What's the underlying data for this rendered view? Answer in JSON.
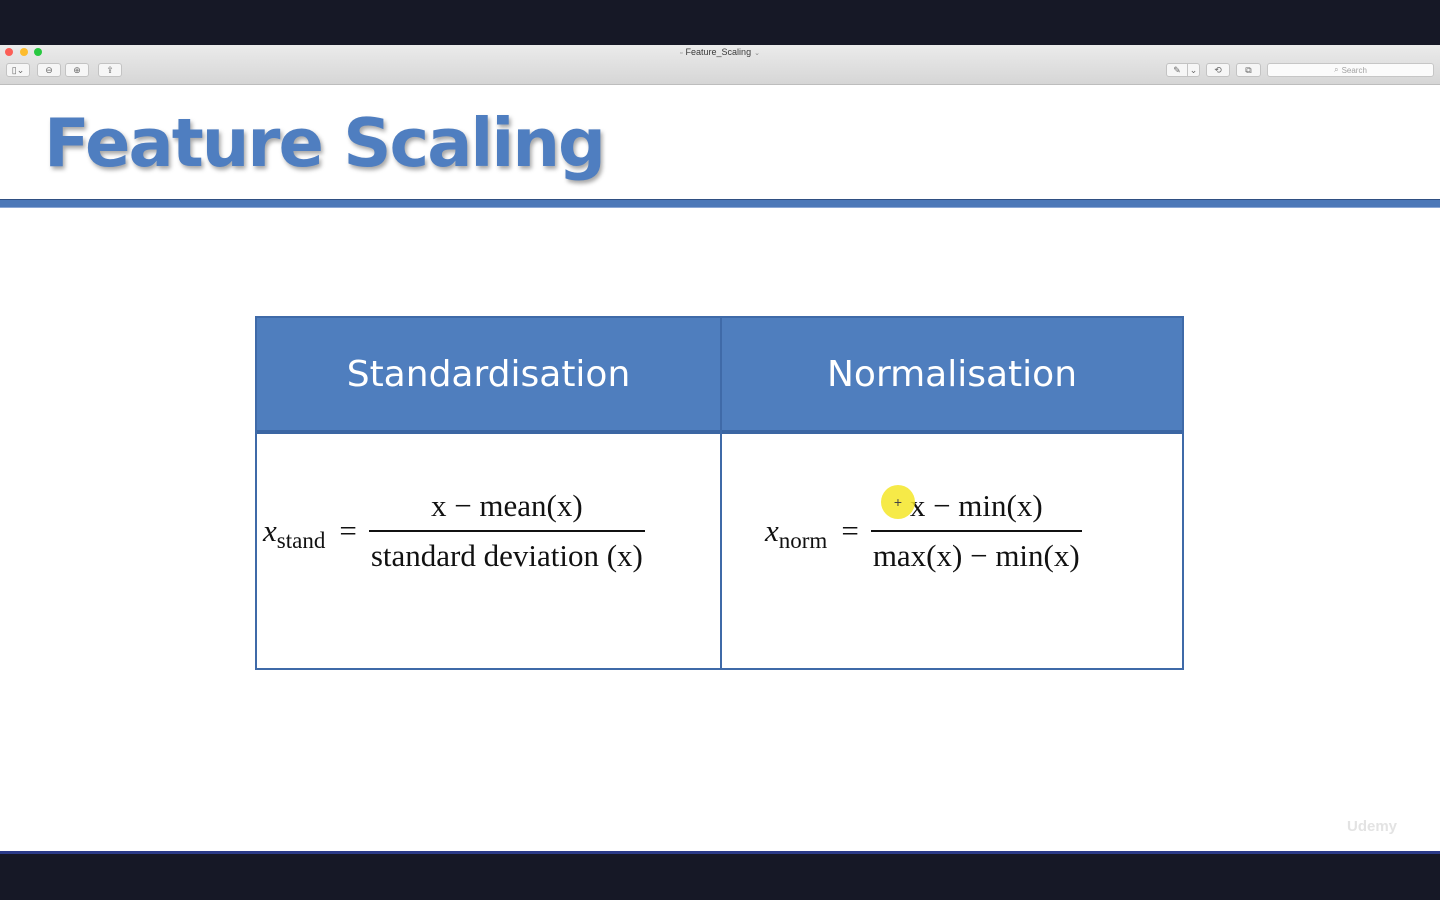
{
  "window": {
    "title": "Feature_Scaling",
    "doc_icon": "▫",
    "title_menu_icon": "⌄"
  },
  "toolbar": {
    "sidebar_icon": "▯⌄",
    "zoom_out_icon": "⊖",
    "zoom_in_icon": "⊕",
    "share_icon": "⇪",
    "markup_icon": "✎",
    "markup_menu_icon": "⌄",
    "rotate_icon": "⟲",
    "toolbox_icon": "⧉",
    "search_placeholder": "Search"
  },
  "slide": {
    "title": "Feature Scaling",
    "table": {
      "headers": [
        "Standardisation",
        "Normalisation"
      ],
      "standardisation_formula": {
        "variable": "x",
        "subscript": "stand",
        "equals": "=",
        "numerator": "x − mean(x)",
        "denominator": "standard deviation (x)"
      },
      "normalisation_formula": {
        "variable": "x",
        "subscript": "norm",
        "equals": "=",
        "numerator": "x − min(x)",
        "denominator": "max(x) − min(x)"
      }
    }
  },
  "cursor_symbol": "+",
  "watermark": "Udemy",
  "colors": {
    "accent": "#4f7ec0",
    "header_bg": "#4f7ebe",
    "border": "#3f6aa8"
  }
}
